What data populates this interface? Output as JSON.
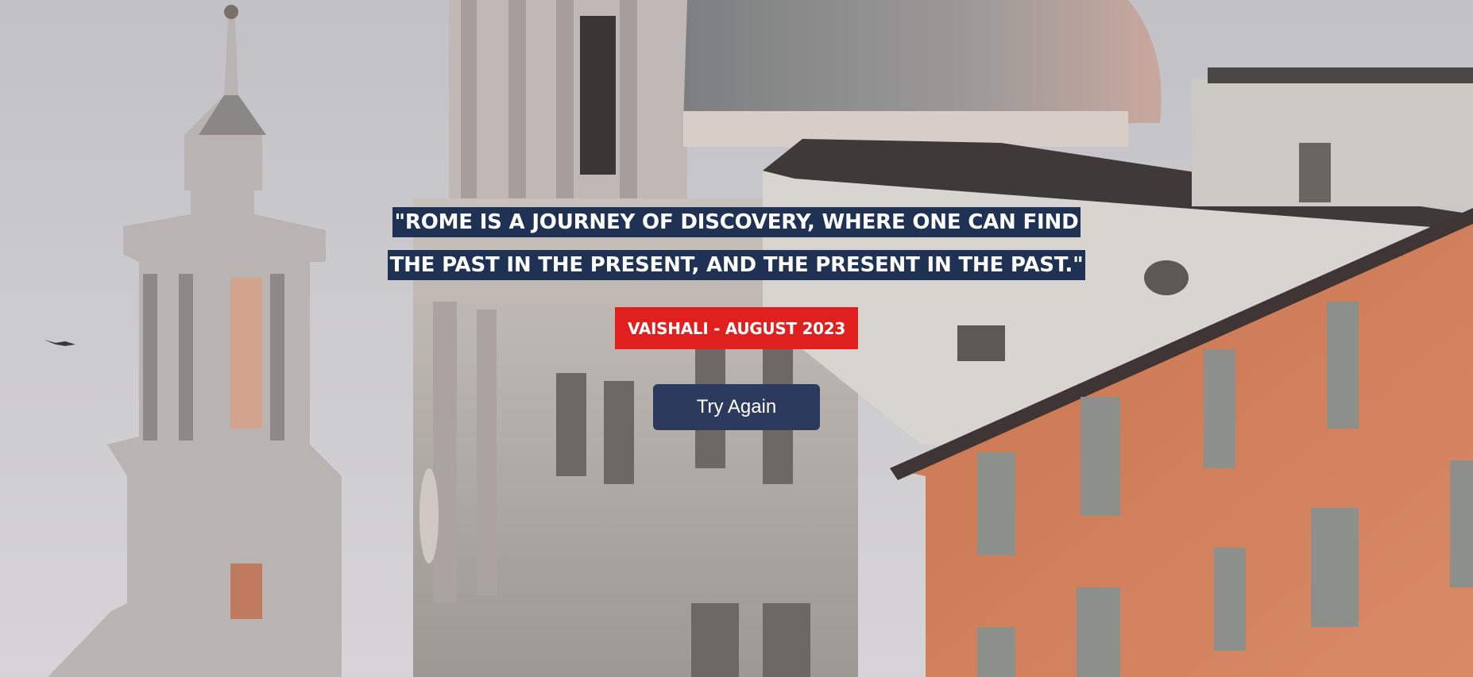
{
  "quote": {
    "text": "\"ROME IS A JOURNEY OF DISCOVERY, WHERE ONE CAN FIND THE PAST IN THE PRESENT, AND THE PRESENT IN THE PAST.\""
  },
  "byline": {
    "text": "VAISHALI - AUGUST 2023"
  },
  "actions": {
    "try_again_label": "Try Again"
  },
  "colors": {
    "quote_highlight": "#1f3254",
    "byline_background": "#e0201e",
    "button_background": "#2c3a5e",
    "building_orange": "#c97450"
  },
  "background": {
    "icon": "rome-architecture-photo"
  }
}
